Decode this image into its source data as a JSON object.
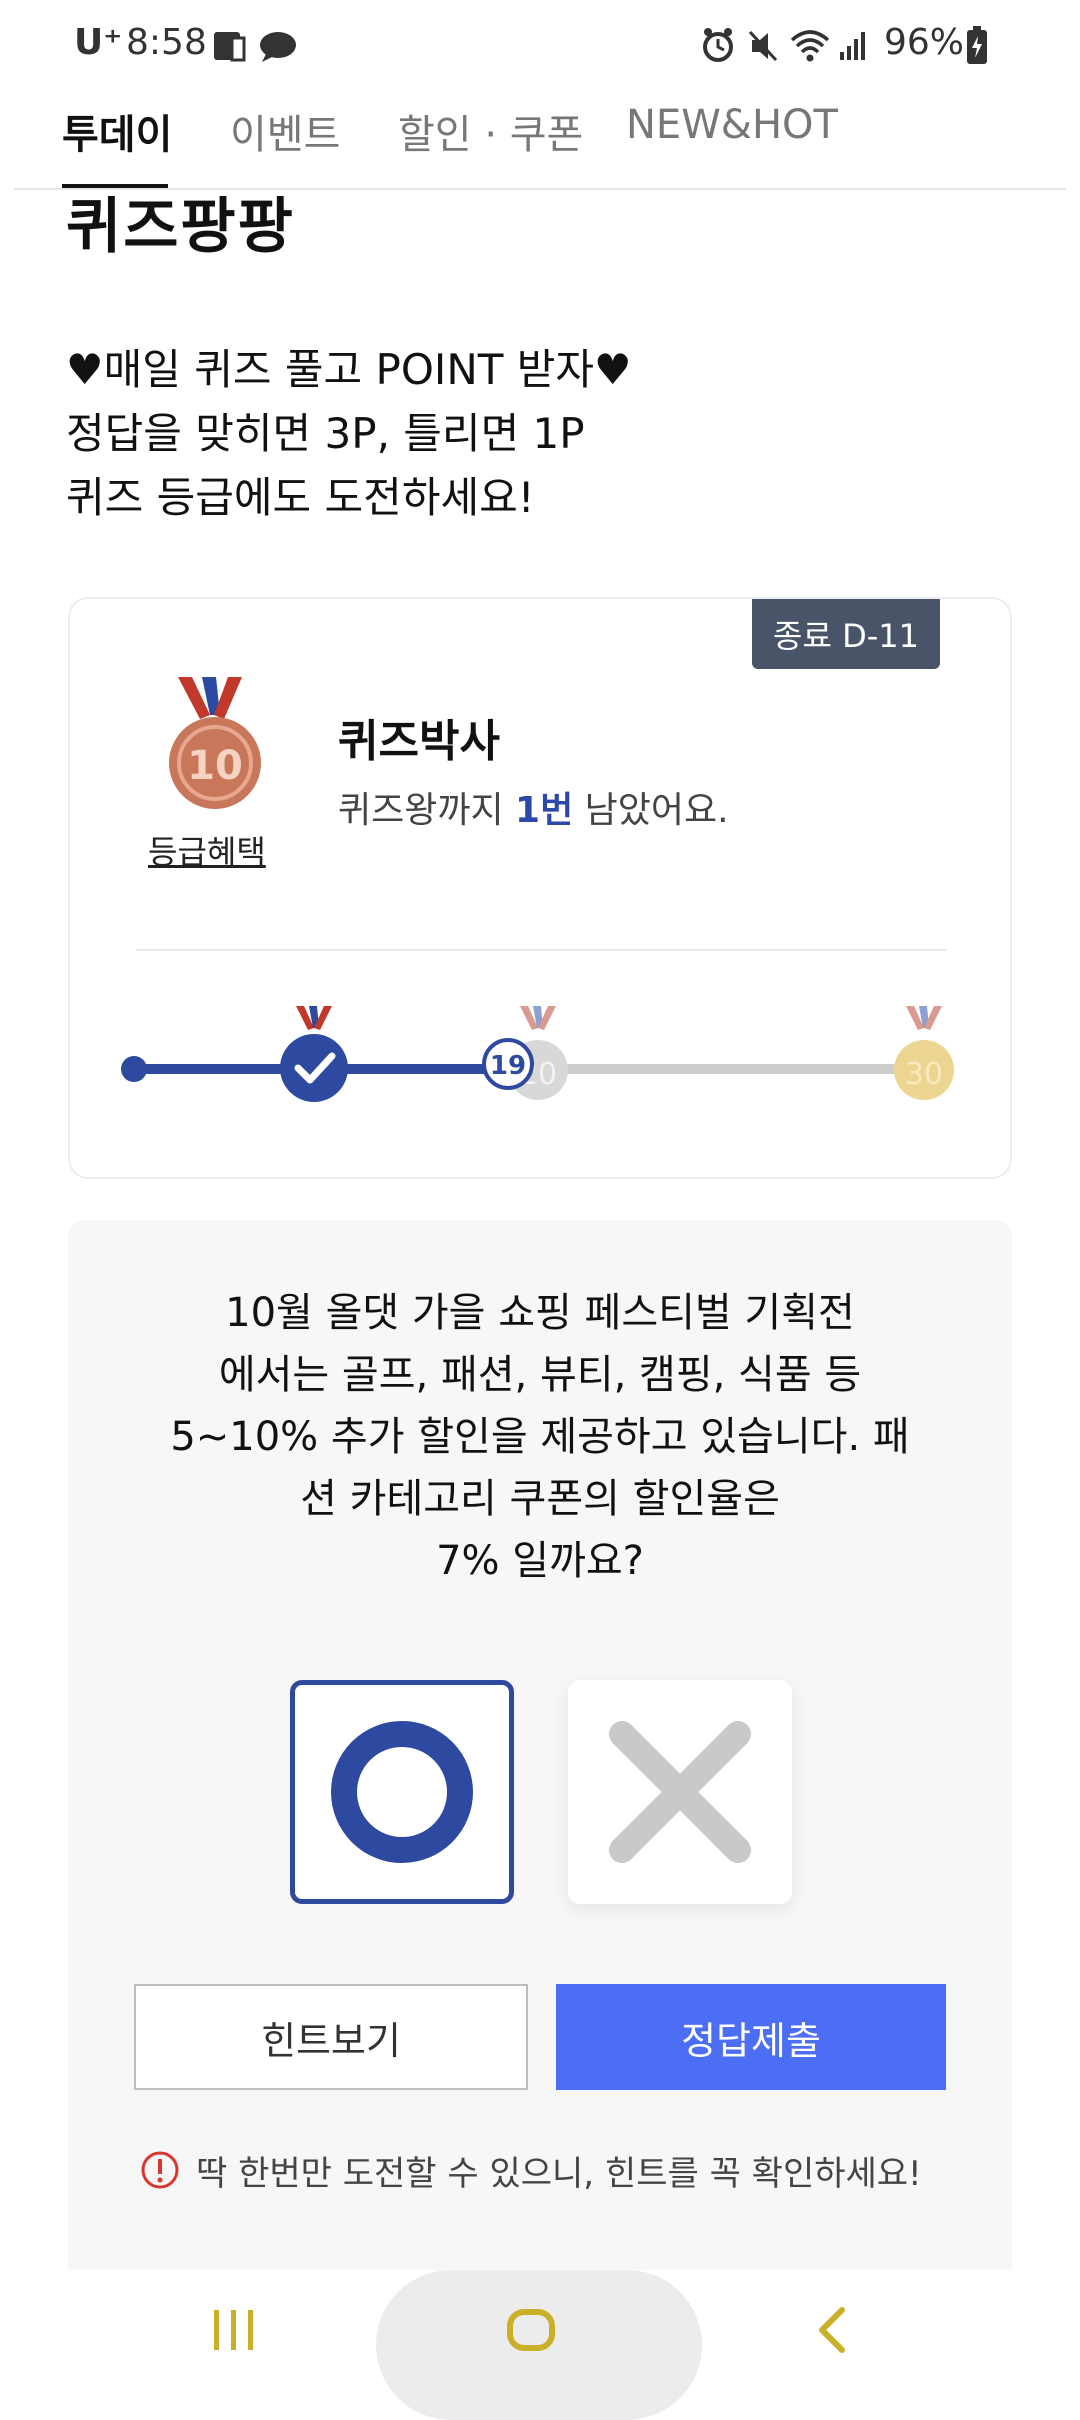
{
  "status_bar": {
    "carrier": "U⁺",
    "time": "8:58",
    "battery": "96%"
  },
  "tabs": [
    {
      "label": "투데이",
      "active": true
    },
    {
      "label": "이벤트",
      "active": false
    },
    {
      "label": "할인 · 쿠폰",
      "active": false
    },
    {
      "label": "NEW&HOT",
      "active": false
    }
  ],
  "page_title": "퀴즈팡팡",
  "intro_lines": [
    "♥매일 퀴즈 풀고 POINT 받자♥",
    "정답을 맞히면 3P, 틀리면 1P",
    "퀴즈 등급에도 도전하세요!"
  ],
  "grade_card": {
    "dday": "종료 D-11",
    "medal_number": "10",
    "benefit_link": "등급혜택",
    "grade_name": "퀴즈박사",
    "desc_prefix": "퀴즈왕까지 ",
    "desc_count": "1번",
    "desc_suffix": " 남았어요.",
    "progress": {
      "current_count": "19",
      "milestones": [
        "10",
        "20",
        "30"
      ],
      "colors": {
        "active": "#2d4aa0",
        "inactive": "#cccccc",
        "bronze": "#c8775a",
        "silver": "#cfcfcf",
        "gold": "#e8cf86"
      }
    }
  },
  "quiz": {
    "question_lines": [
      "10월 올댓 가을 쇼핑 페스티벌 기획전",
      "에서는 골프, 패션, 뷰티, 캠핑, 식품 등",
      "5~10% 추가 할인을 제공하고 있습니다. 패",
      "션 카테고리 쿠폰의 할인율은",
      "7% 일까요?"
    ],
    "answer_o_icon": "circle-o-icon",
    "answer_x_icon": "cross-x-icon",
    "selected": "O",
    "hint_button": "힌트보기",
    "submit_button": "정답제출",
    "notice": "딱 한번만 도전할 수 있으니, 힌트를 꼭 확인하세요!"
  },
  "colors": {
    "accent_blue": "#2d4aa0",
    "submit_blue": "#4c6ef5",
    "dday_bg": "#4a5468",
    "nav_icon": "#c9b028",
    "notice_red": "#d9362f"
  }
}
